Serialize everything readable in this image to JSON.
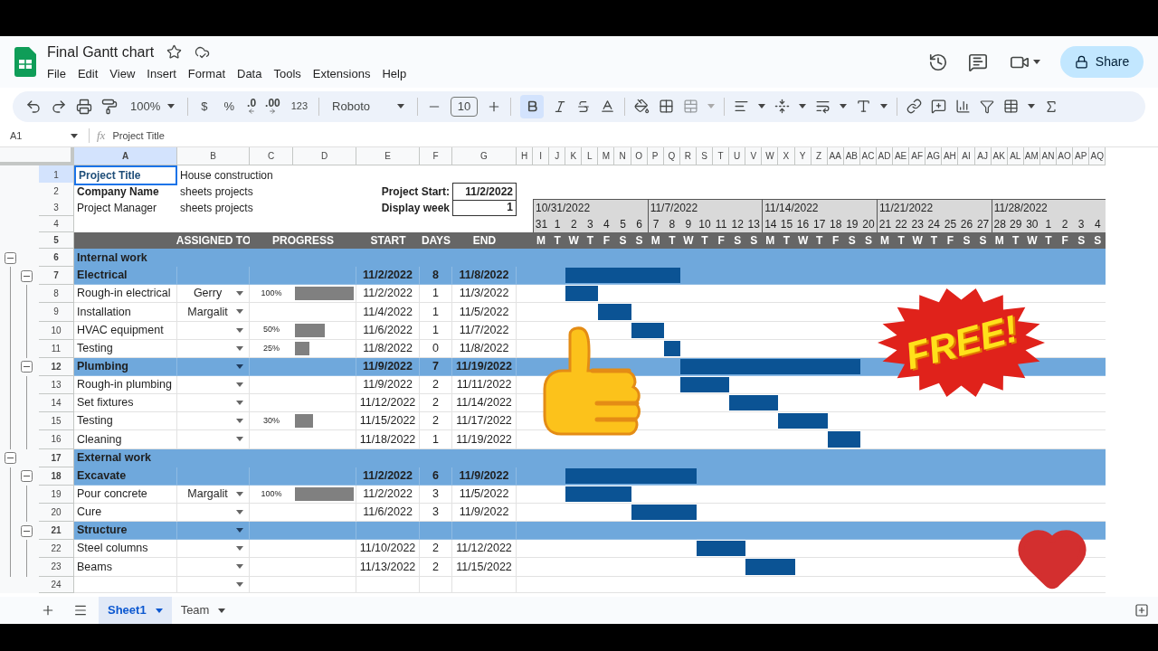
{
  "app": {
    "title": "Final Gantt chart",
    "menu": [
      "File",
      "Edit",
      "View",
      "Insert",
      "Format",
      "Data",
      "Tools",
      "Extensions",
      "Help"
    ],
    "share": "Share"
  },
  "toolbar": {
    "zoom": "100%",
    "currency": "$",
    "percent": "%",
    "decimals_less": ".0",
    "decimals_more": ".00",
    "number_format": "123",
    "font": "Roboto",
    "font_size": "10",
    "bold_active": true
  },
  "formula_bar": {
    "cell": "A1",
    "function_label": "fx",
    "content": "Project Title"
  },
  "column_letters": [
    "A",
    "B",
    "C",
    "D",
    "E",
    "F",
    "G",
    "H",
    "I",
    "J",
    "K",
    "L",
    "M",
    "N",
    "O",
    "P",
    "Q",
    "R",
    "S",
    "T",
    "U",
    "V",
    "W",
    "X",
    "Y",
    "Z",
    "AA",
    "AB",
    "AC",
    "AD",
    "AE",
    "AF",
    "AG",
    "AH",
    "AI",
    "AJ",
    "AK",
    "AL",
    "AM",
    "AN",
    "AO",
    "AP",
    "AQ"
  ],
  "row_numbers": [
    "1",
    "2",
    "3",
    "4",
    "5",
    "6",
    "7",
    "8",
    "9",
    "10",
    "11",
    "12",
    "13",
    "14",
    "15",
    "16",
    "17",
    "18",
    "19",
    "20",
    "21",
    "22",
    "23",
    "24"
  ],
  "info": [
    {
      "label": "Project Title",
      "value": "House construction",
      "bold": true,
      "selected": true
    },
    {
      "label": "Company Name",
      "value": "sheets projects",
      "bold": true,
      "selected": false
    },
    {
      "label": "Project Manager",
      "value": "sheets projects",
      "bold": false,
      "selected": false
    }
  ],
  "project_start": {
    "label": "Project Start:",
    "value": "11/2/2022"
  },
  "display_week": {
    "label": "Display week",
    "value": "1"
  },
  "weeks": [
    {
      "label": "10/31/2022",
      "days": [
        "31",
        "1",
        "2",
        "3",
        "4",
        "5",
        "6"
      ]
    },
    {
      "label": "11/7/2022",
      "days": [
        "7",
        "8",
        "9",
        "10",
        "11",
        "12",
        "13"
      ]
    },
    {
      "label": "11/14/2022",
      "days": [
        "14",
        "15",
        "16",
        "17",
        "18",
        "19",
        "20"
      ]
    },
    {
      "label": "11/21/2022",
      "days": [
        "21",
        "22",
        "23",
        "24",
        "25",
        "26",
        "27"
      ]
    },
    {
      "label": "11/28/2022",
      "days": [
        "28",
        "29",
        "30",
        "1",
        "2",
        "3",
        "4"
      ]
    }
  ],
  "columns": {
    "assigned": "ASSIGNED TO",
    "progress": "PROGRESS",
    "start": "START",
    "days": "DAYS",
    "end": "END"
  },
  "weekday_letters": [
    "M",
    "T",
    "W",
    "T",
    "F",
    "S",
    "S",
    "M",
    "T",
    "W",
    "T",
    "F",
    "S",
    "S",
    "M",
    "T",
    "W",
    "T",
    "F",
    "S",
    "S",
    "M",
    "T",
    "W",
    "T",
    "F",
    "S",
    "S",
    "M",
    "T",
    "W",
    "T",
    "F",
    "S",
    "S"
  ],
  "tasks": [
    {
      "kind": "group",
      "name": "Internal work"
    },
    {
      "kind": "phase",
      "name": "Electrical",
      "start": "11/2/2022",
      "days": "8",
      "end": "11/8/2022",
      "dropdown": false
    },
    {
      "kind": "task",
      "name": "Rough-in electrical",
      "assigned": "Gerry",
      "progress": "100%",
      "level": 1,
      "start": "11/2/2022",
      "days": "1",
      "end": "11/3/2022",
      "dropdown": true
    },
    {
      "kind": "task",
      "name": "Installation",
      "assigned": "Margalit",
      "start": "11/4/2022",
      "days": "1",
      "end": "11/5/2022",
      "dropdown": true
    },
    {
      "kind": "task",
      "name": "HVAC equipment",
      "progress": "50%",
      "level": 0.5,
      "start": "11/6/2022",
      "days": "1",
      "end": "11/7/2022",
      "dropdown": true
    },
    {
      "kind": "task",
      "name": "Testing",
      "progress": "25%",
      "level": 0.25,
      "start": "11/8/2022",
      "days": "0",
      "end": "11/8/2022",
      "dropdown": true
    },
    {
      "kind": "phase",
      "name": "Plumbing",
      "start": "11/9/2022",
      "days": "7",
      "end": "11/19/2022",
      "dropdown": true
    },
    {
      "kind": "task",
      "name": "Rough-in plumbing",
      "start": "11/9/2022",
      "days": "2",
      "end": "11/11/2022",
      "dropdown": true
    },
    {
      "kind": "task",
      "name": "Set fixtures",
      "start": "11/12/2022",
      "days": "2",
      "end": "11/14/2022",
      "dropdown": true
    },
    {
      "kind": "task",
      "name": "Testing",
      "progress": "30%",
      "level": 0.3,
      "start": "11/15/2022",
      "days": "2",
      "end": "11/17/2022",
      "dropdown": true
    },
    {
      "kind": "task",
      "name": "Cleaning",
      "start": "11/18/2022",
      "days": "1",
      "end": "11/19/2022",
      "dropdown": true
    },
    {
      "kind": "group",
      "name": "External work"
    },
    {
      "kind": "phase",
      "name": "Excavate",
      "start": "11/2/2022",
      "days": "6",
      "end": "11/9/2022",
      "dropdown": false
    },
    {
      "kind": "task",
      "name": "Pour concrete",
      "assigned": "Margalit",
      "progress": "100%",
      "level": 1,
      "start": "11/2/2022",
      "days": "3",
      "end": "11/5/2022",
      "dropdown": true
    },
    {
      "kind": "task",
      "name": "Cure",
      "start": "11/6/2022",
      "days": "3",
      "end": "11/9/2022",
      "dropdown": true
    },
    {
      "kind": "phase",
      "name": "Structure",
      "dropdown": true
    },
    {
      "kind": "task",
      "name": "Steel columns",
      "start": "11/10/2022",
      "days": "2",
      "end": "11/12/2022",
      "dropdown": true
    },
    {
      "kind": "task",
      "name": "Beams",
      "start": "11/13/2022",
      "days": "2",
      "end": "11/15/2022",
      "dropdown": true
    },
    {
      "kind": "blank",
      "dropdown": true
    }
  ],
  "sheet_tabs": [
    {
      "label": "Sheet1",
      "selected": true
    },
    {
      "label": "Team",
      "selected": false
    }
  ],
  "sticker": {
    "text": "FREE!"
  }
}
